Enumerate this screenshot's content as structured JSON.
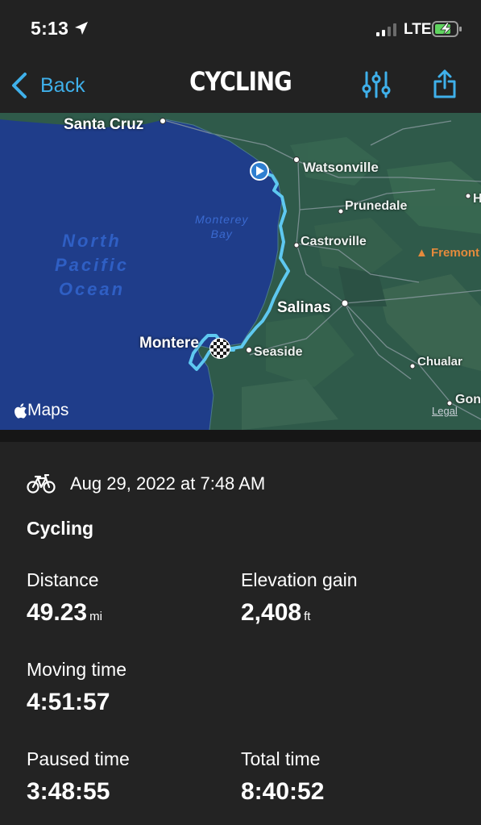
{
  "status_bar": {
    "time": "5:13",
    "network": "LTE",
    "icons": [
      "location-arrow-icon",
      "signal-bars-icon",
      "battery-charging-icon"
    ]
  },
  "nav": {
    "back_label": "Back",
    "title": "CYCLING",
    "icons": [
      "chevron-left-icon",
      "sliders-icon",
      "share-icon"
    ]
  },
  "map": {
    "ocean_label_lines": [
      "North",
      "Pacific",
      "Ocean"
    ],
    "bay_label_lines": [
      "Monterey",
      "Bay"
    ],
    "places": {
      "santa_cruz": "Santa Cruz",
      "watsonville": "Watsonville",
      "prunedale": "Prunedale",
      "castroville": "Castroville",
      "fremont": "Fremont",
      "salinas": "Salinas",
      "monterey": "Montere",
      "seaside": "Seaside",
      "chualar": "Chualar",
      "gonzales": "Gon",
      "h_cut": "H"
    },
    "attribution": "Maps",
    "legal": "Legal",
    "colors": {
      "ocean": "#1f3d8a",
      "land": "#2f5a4a",
      "route": "#5ec8f0"
    }
  },
  "workout": {
    "date": "Aug 29, 2022 at 7:48 AM",
    "activity_type": "Cycling",
    "stats": {
      "distance": {
        "label": "Distance",
        "value": "49.23",
        "unit": "mi"
      },
      "elevation_gain": {
        "label": "Elevation gain",
        "value": "2,408",
        "unit": "ft"
      },
      "moving_time": {
        "label": "Moving time",
        "value": "4:51:57"
      },
      "paused_time": {
        "label": "Paused time",
        "value": "3:48:55"
      },
      "total_time": {
        "label": "Total time",
        "value": "8:40:52"
      }
    }
  }
}
